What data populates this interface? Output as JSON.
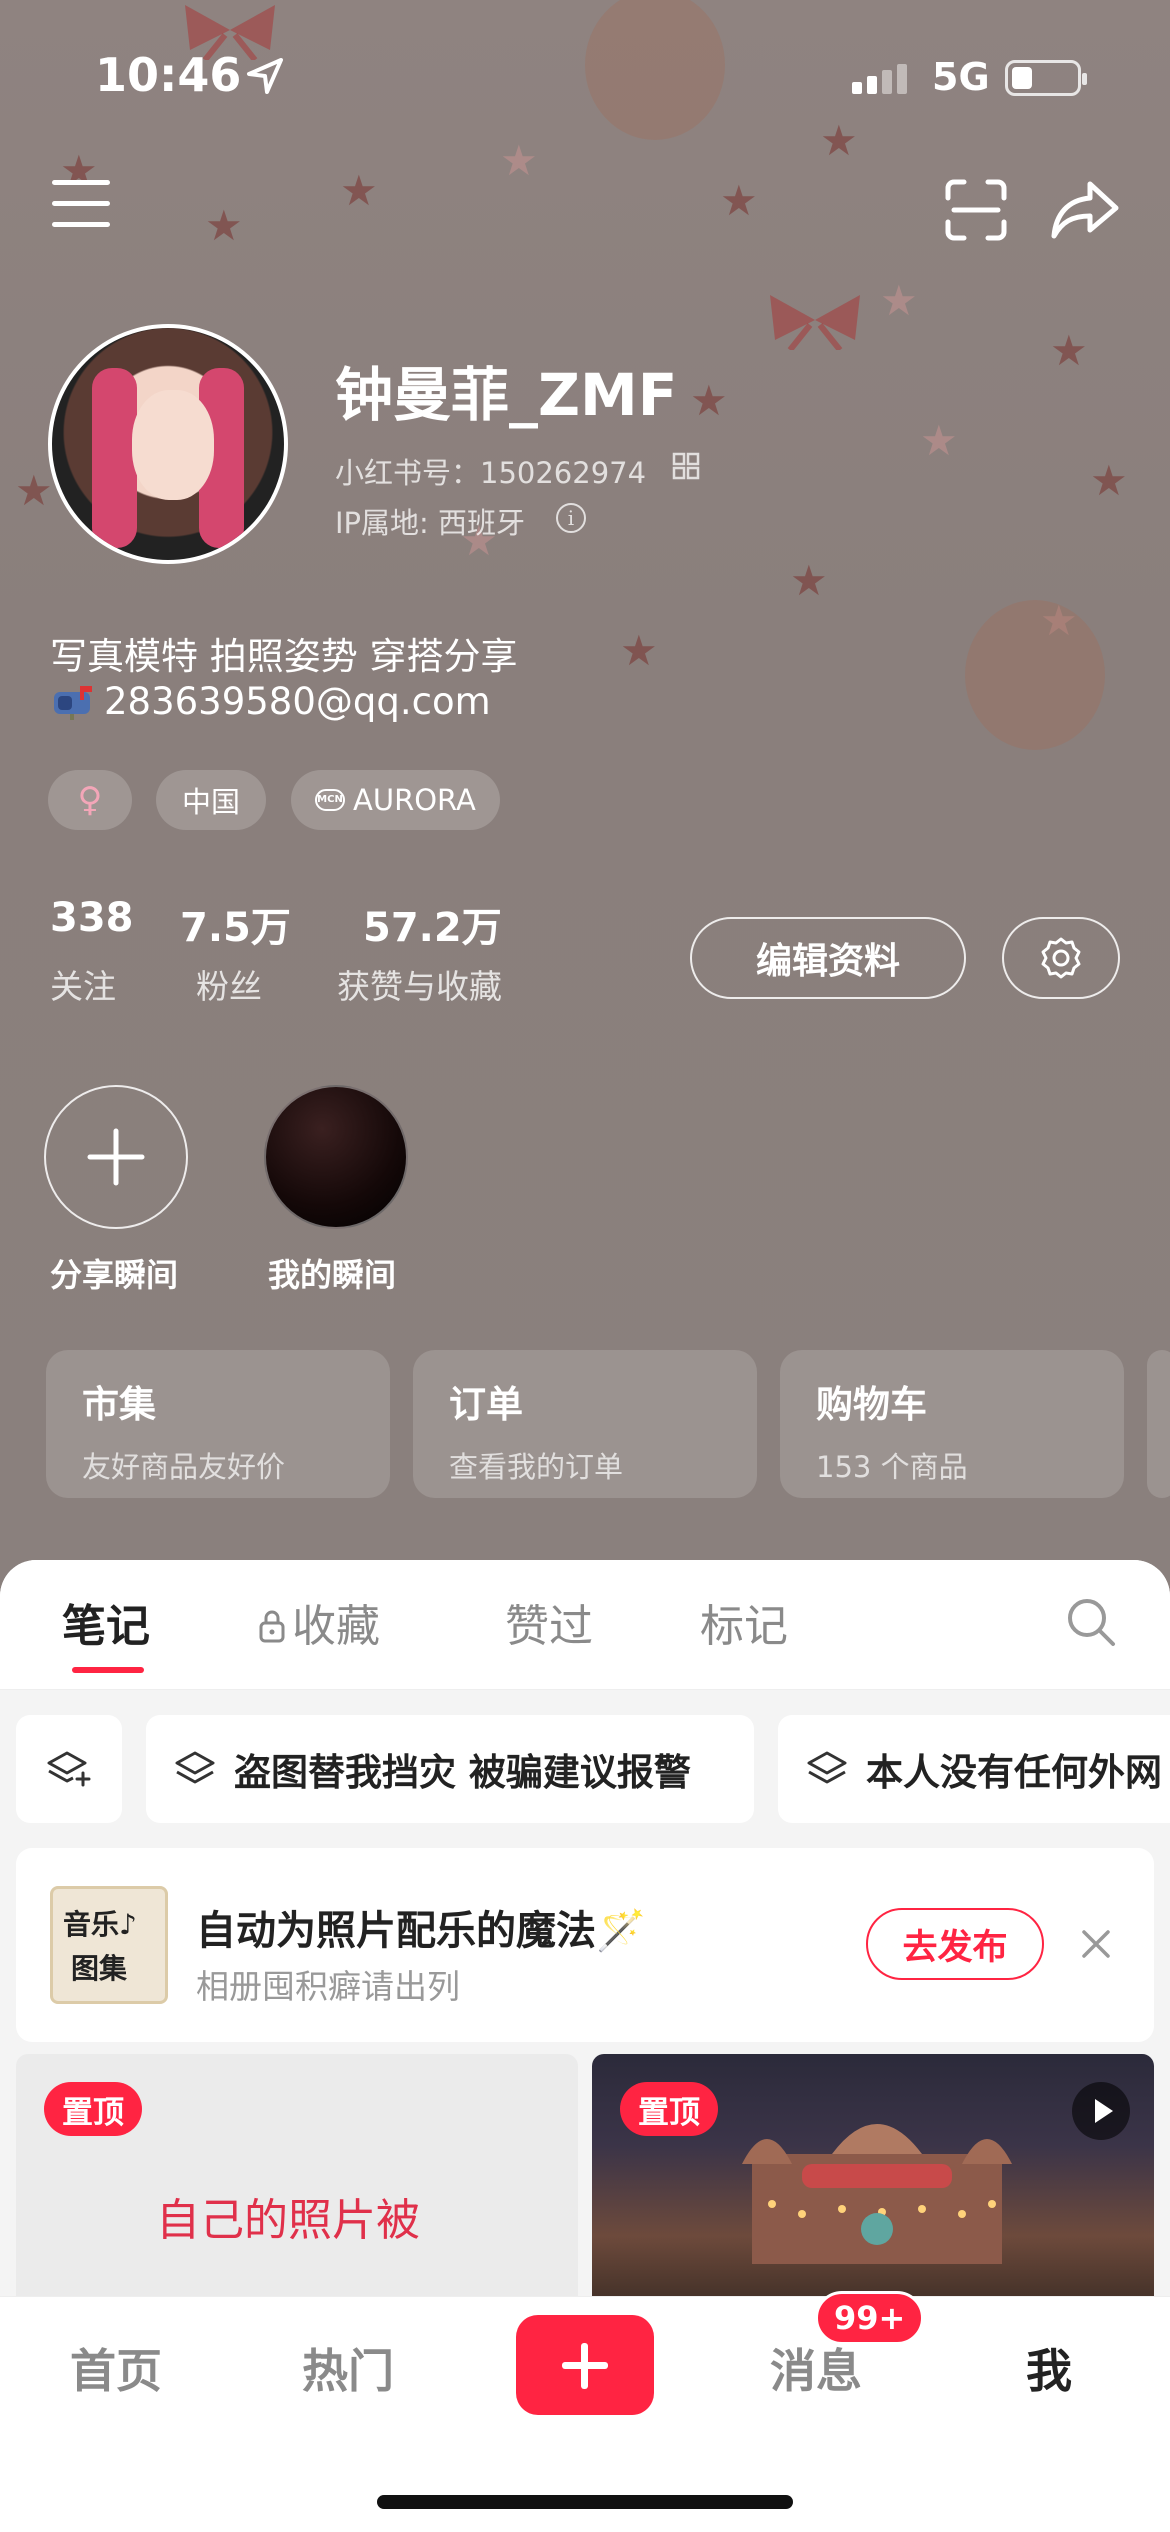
{
  "status_bar": {
    "time": "10:46",
    "network": "5G"
  },
  "profile": {
    "username": "钟曼菲_ZMF",
    "redid_label": "小红书号：150262974",
    "ip_label": "IP属地: 西班牙",
    "bio_line1": "写真模特 拍照姿势 穿搭分享",
    "bio_email": "283639580@qq.com",
    "tags": {
      "gender": "♀",
      "region": "中国",
      "mcn": "AURORA"
    },
    "stats": [
      {
        "value": "338",
        "label": "关注"
      },
      {
        "value": "7.5万",
        "label": "粉丝"
      },
      {
        "value": "57.2万",
        "label": "获赞与收藏"
      }
    ],
    "edit_label": "编辑资料"
  },
  "moments": {
    "add_label": "分享瞬间",
    "mine_label": "我的瞬间"
  },
  "quick_cards": [
    {
      "title": "市集",
      "subtitle": "友好商品友好价"
    },
    {
      "title": "订单",
      "subtitle": "查看我的订单"
    },
    {
      "title": "购物车",
      "subtitle": "153 个商品"
    }
  ],
  "tabs": {
    "notes": "笔记",
    "collections": "收藏",
    "likes": "赞过",
    "marks": "标记"
  },
  "chips": [
    "盗图替我挡灾 被骗建议报警",
    "本人没有任何外网"
  ],
  "promo": {
    "thumb_line1": "音乐♪",
    "thumb_line2": "图集",
    "title": "自动为照片配乐的魔法🪄",
    "subtitle": "相册囤积癖请出列",
    "button": "去发布"
  },
  "notes": [
    {
      "badge": "置顶",
      "text": "自己的照片被"
    },
    {
      "badge": "置顶",
      "text": ""
    }
  ],
  "bottom_nav": {
    "home": "首页",
    "hot": "热门",
    "messages": "消息",
    "me": "我",
    "badge": "99+"
  }
}
